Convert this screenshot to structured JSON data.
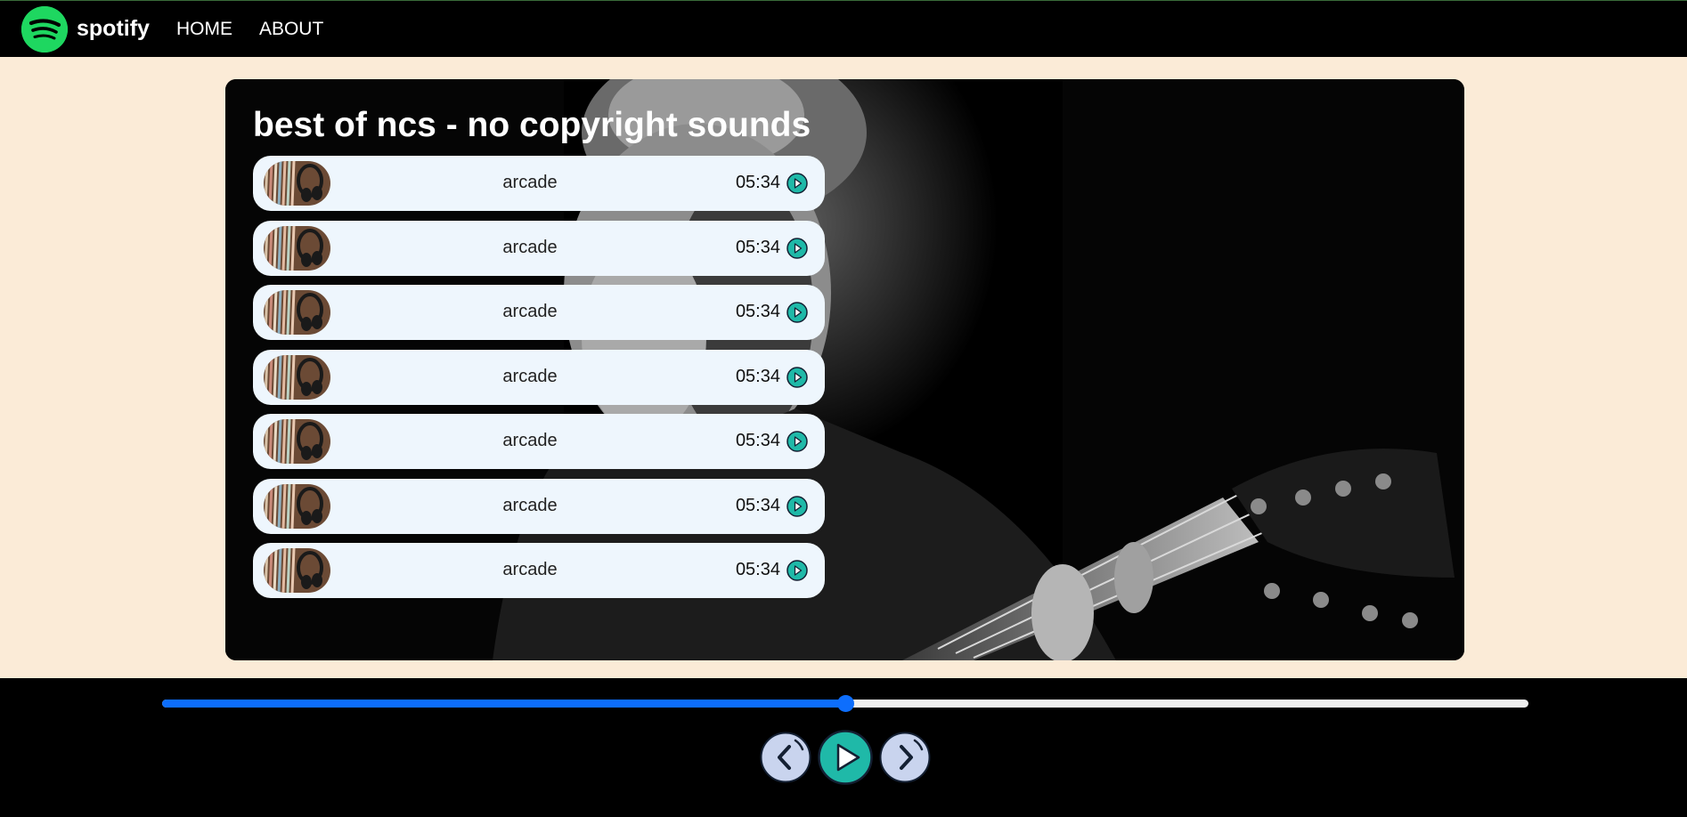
{
  "nav": {
    "brand": "spotify",
    "links": [
      "HOME",
      "ABOUT"
    ]
  },
  "playlist": {
    "title": "best of ncs - no copyright sounds",
    "songs": [
      {
        "name": "arcade",
        "duration": "05:34"
      },
      {
        "name": "arcade",
        "duration": "05:34"
      },
      {
        "name": "arcade",
        "duration": "05:34"
      },
      {
        "name": "arcade",
        "duration": "05:34"
      },
      {
        "name": "arcade",
        "duration": "05:34"
      },
      {
        "name": "arcade",
        "duration": "05:34"
      },
      {
        "name": "arcade",
        "duration": "05:34"
      }
    ]
  },
  "player": {
    "progress_percent": 50,
    "controls": [
      "previous-icon",
      "play-icon",
      "next-icon"
    ]
  },
  "colors": {
    "page_bg": "#fbebd7",
    "accent_green": "#1ed760",
    "progress_blue": "#0d6efd",
    "play_teal": "#1fb9a8",
    "song_bg": "#eef6fd"
  }
}
